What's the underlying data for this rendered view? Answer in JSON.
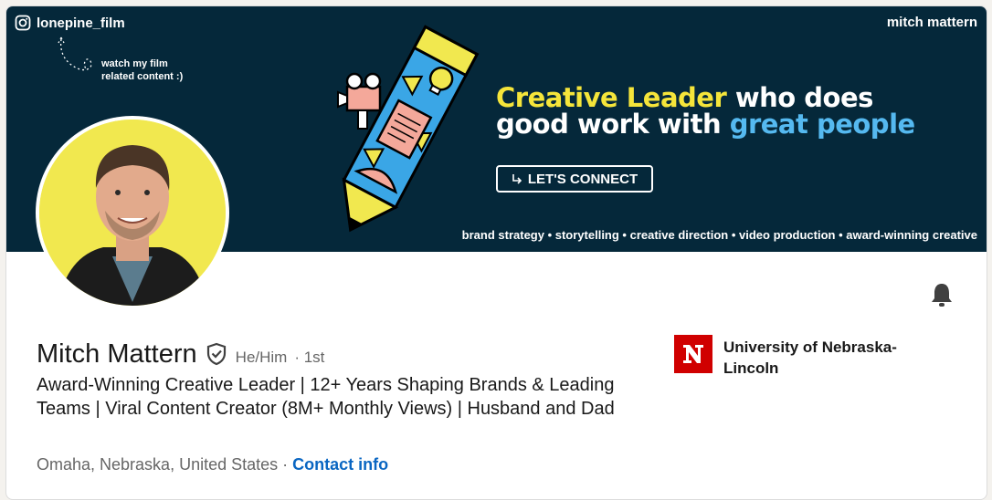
{
  "banner": {
    "instagram_handle": "lonepine_film",
    "owner": "mitch mattern",
    "note_line1": "watch my film",
    "note_line2": "related content :)",
    "headline_part1": "Creative Leader",
    "headline_part2": " who does",
    "headline_part3": "good work with ",
    "headline_part4": "great people",
    "connect_button": "LET'S CONNECT",
    "tagline": "brand strategy • storytelling • creative direction • video production • award-winning creative",
    "colors": {
      "background": "#05283a",
      "yellow": "#f5e53a",
      "blue": "#55b9f0"
    }
  },
  "profile": {
    "name": "Mitch Mattern",
    "pronouns": "He/Him",
    "degree": "· 1st",
    "headline": "Award-Winning Creative Leader | 12+ Years Shaping Brands & Leading Teams | Viral Content Creator (8M+ Monthly Views) | Husband and Dad",
    "location": "Omaha, Nebraska, United States",
    "separator": " · ",
    "contact_info": "Contact info"
  },
  "education": {
    "school_name": "University of Nebraska-Lincoln",
    "logo_letter": "N"
  },
  "icons": {
    "notify": "bell-icon",
    "verified": "shield-check-icon",
    "instagram": "instagram-icon"
  }
}
